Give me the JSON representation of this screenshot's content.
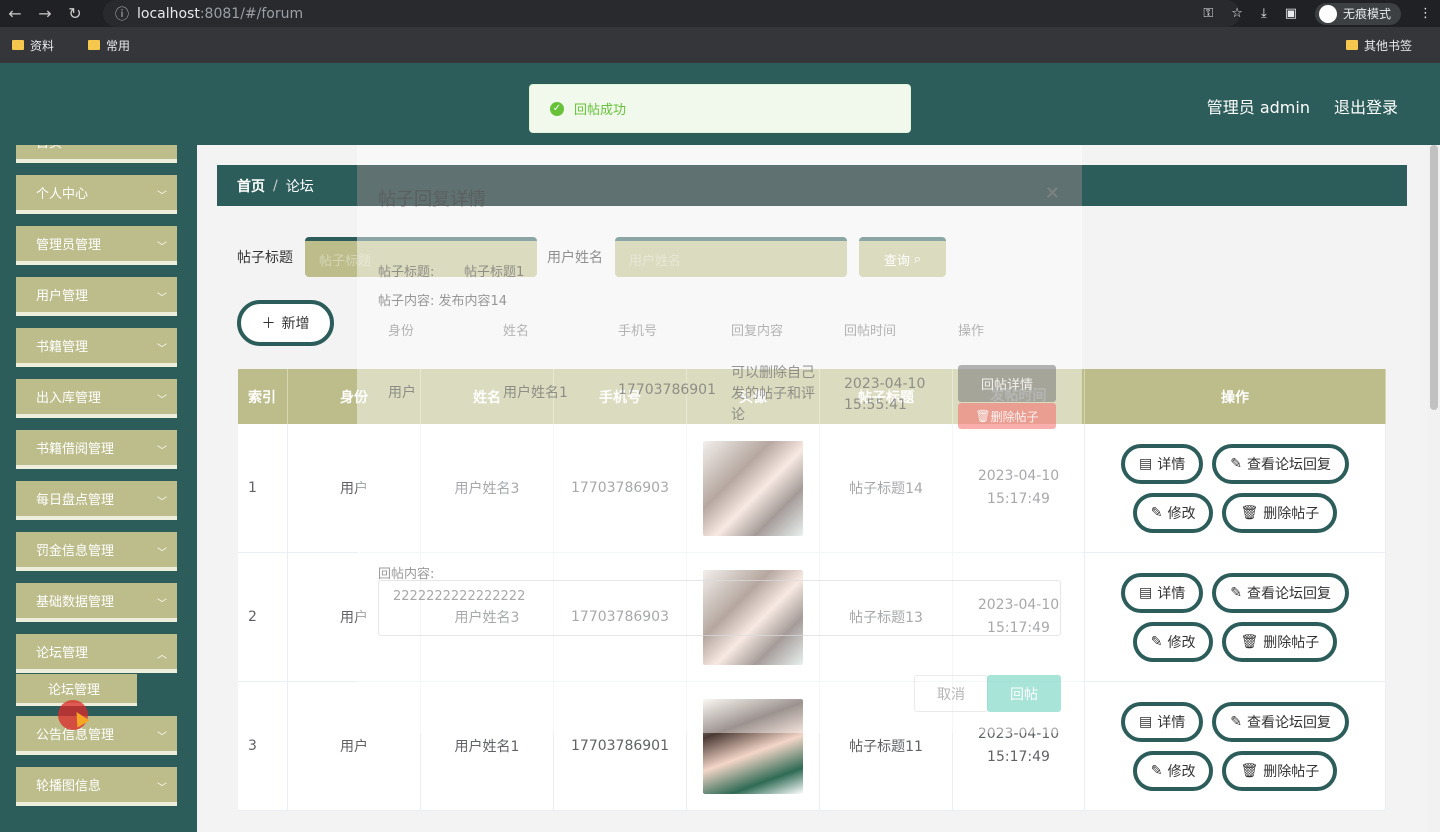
{
  "browser": {
    "url_host": "localhost",
    "url_rest": ":8081/#/forum",
    "incognito_label": "无痕模式",
    "bookmarks": [
      "资料",
      "常用"
    ],
    "other_bookmarks": "其他书签"
  },
  "header": {
    "admin_label": "管理员 admin",
    "logout_label": "退出登录"
  },
  "toast": {
    "message": "回帖成功"
  },
  "sidebar": {
    "items": [
      {
        "label": "首页"
      },
      {
        "label": "个人中心"
      },
      {
        "label": "管理员管理"
      },
      {
        "label": "用户管理"
      },
      {
        "label": "书籍管理"
      },
      {
        "label": "出入库管理"
      },
      {
        "label": "书籍借阅管理"
      },
      {
        "label": "每日盘点管理"
      },
      {
        "label": "罚金信息管理"
      },
      {
        "label": "基础数据管理"
      },
      {
        "label": "论坛管理"
      },
      {
        "label": "公告信息管理"
      },
      {
        "label": "轮播图信息"
      }
    ],
    "submenu_label": "论坛管理"
  },
  "breadcrumb": {
    "home": "首页",
    "separator": "/",
    "current": "论坛"
  },
  "search": {
    "title_label": "帖子标题",
    "title_placeholder": "帖子标题",
    "name_label": "用户姓名",
    "name_placeholder": "用户姓名",
    "query_label": "查询"
  },
  "add_label": "新增",
  "table": {
    "headers": [
      "索引",
      "身份",
      "姓名",
      "手机号",
      "头像",
      "帖子标题",
      "发帖时间",
      "操作"
    ],
    "rows": [
      {
        "index": "1",
        "role": "用户",
        "name": "用户姓名3",
        "phone": "17703786903",
        "title": "帖子标题14",
        "time": "2023-04-10 15:17:49"
      },
      {
        "index": "2",
        "role": "用户",
        "name": "用户姓名3",
        "phone": "17703786903",
        "title": "帖子标题13",
        "time": "2023-04-10 15:17:49"
      },
      {
        "index": "3",
        "role": "用户",
        "name": "用户姓名1",
        "phone": "17703786901",
        "title": "帖子标题11",
        "time": "2023-04-10 15:17:49"
      }
    ],
    "op_labels": {
      "detail": "详情",
      "view_reply": "查看论坛回复",
      "edit": "修改",
      "delete": "删除帖子"
    }
  },
  "dialog": {
    "title": "帖子回复详情",
    "post_title_label": "帖子标题:",
    "post_title_value": "帖子标题1",
    "post_content": "帖子内容: 发布内容14",
    "cols": [
      "身份",
      "姓名",
      "手机号",
      "回复内容",
      "回帖时间",
      "操作"
    ],
    "reply": {
      "role": "用户",
      "name": "用户姓名1",
      "phone": "17703786901",
      "content": "可以删除自己发的帖子和评论",
      "time": "2023-04-10 15:55:41"
    },
    "reply_detail_label": "回帖详情",
    "reply_delete_label": "删除帖子",
    "reply_content_label": "回帖内容:",
    "reply_content_value": "2222222222222222",
    "cancel_label": "取消",
    "submit_label": "回帖"
  }
}
